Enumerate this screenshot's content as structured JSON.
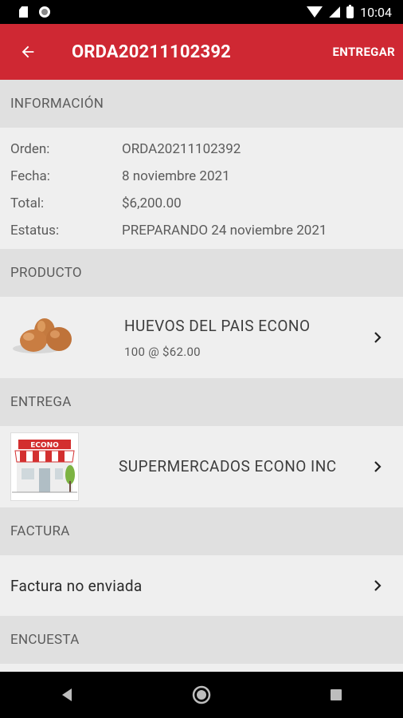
{
  "status_bar": {
    "time": "10:04"
  },
  "app_bar": {
    "title": "ORDA20211102392",
    "action_label": "ENTREGAR",
    "accent": "#cf2833"
  },
  "info": {
    "header": "INFORMACIÓN",
    "rows": [
      {
        "label": "Orden:",
        "value": "ORDA20211102392"
      },
      {
        "label": "Fecha:",
        "value": "8 noviembre 2021"
      },
      {
        "label": "Total:",
        "value": "$6,200.00"
      },
      {
        "label": "Estatus:",
        "value": "PREPARANDO 24 noviembre 2021"
      }
    ]
  },
  "product": {
    "header": "PRODUCTO",
    "name": "HUEVOS DEL PAIS ECONO",
    "detail": "100 @ $62.00"
  },
  "delivery": {
    "header": "ENTREGA",
    "store_logo_text": "ECONO",
    "store_name": "SUPERMERCADOS ECONO INC"
  },
  "invoice": {
    "header": "FACTURA",
    "status": "Factura no enviada"
  },
  "survey": {
    "header": "ENCUESTA"
  }
}
